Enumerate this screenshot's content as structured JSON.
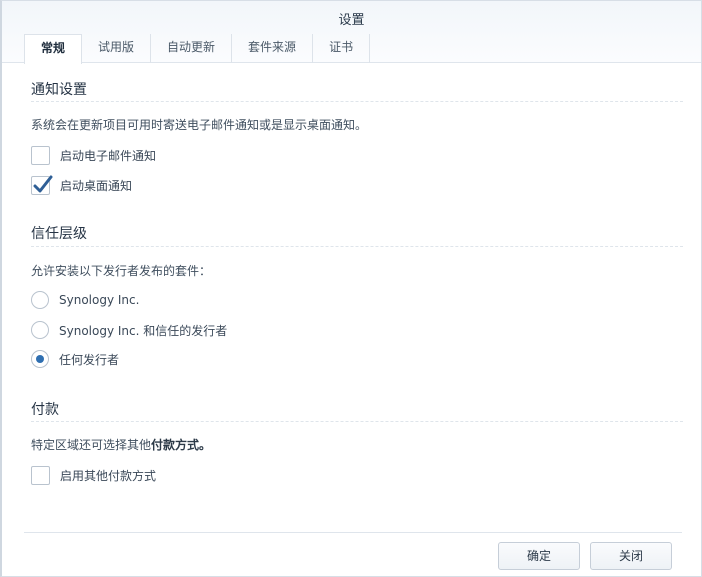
{
  "window": {
    "title": "设置"
  },
  "tabs": [
    {
      "label": "常规",
      "active": true
    },
    {
      "label": "试用版",
      "active": false
    },
    {
      "label": "自动更新",
      "active": false
    },
    {
      "label": "套件来源",
      "active": false
    },
    {
      "label": "证书",
      "active": false
    }
  ],
  "notification": {
    "title": "通知设置",
    "description": "系统会在更新项目可用时寄送电子邮件通知或是显示桌面通知。",
    "email_label": "启动电子邮件通知",
    "email_checked": false,
    "desktop_label": "启动桌面通知",
    "desktop_checked": true
  },
  "trust": {
    "title": "信任层级",
    "description": "允许安装以下发行者发布的套件：",
    "options": [
      {
        "label": "Synology Inc.",
        "selected": false
      },
      {
        "label": "Synology Inc. 和信任的发行者",
        "selected": false
      },
      {
        "label": "任何发行者",
        "selected": true
      }
    ]
  },
  "payment": {
    "title": "付款",
    "description_prefix": "特定区域还可选择其他",
    "description_bold": "付款方式。",
    "enable_label": "启用其他付款方式",
    "enable_checked": false
  },
  "footer": {
    "ok_label": "确定",
    "close_label": "关闭"
  },
  "colors": {
    "accent": "#2f6fb1",
    "header_bg": "#f2f6fa",
    "border": "#dfe5ec"
  }
}
